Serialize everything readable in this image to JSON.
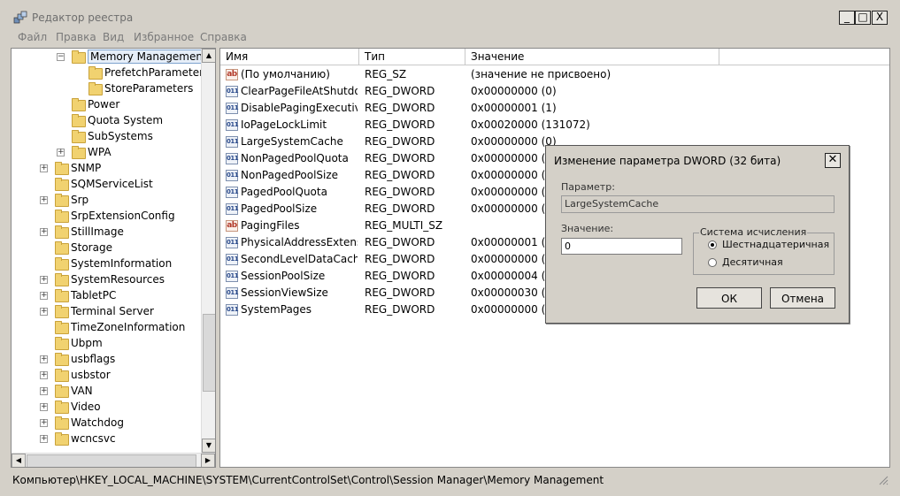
{
  "window": {
    "title": "Редактор реестра",
    "controls": {
      "minimize": "_",
      "maximize": "□",
      "close": "X"
    }
  },
  "menu": [
    "Файл",
    "Правка",
    "Вид",
    "Избранное",
    "Справка"
  ],
  "tree": {
    "selected": "Memory Management",
    "items": [
      {
        "label": "Memory Management",
        "level": 3,
        "expander": "minus",
        "selected": true
      },
      {
        "label": "PrefetchParameters",
        "level": 4,
        "expander": "none"
      },
      {
        "label": "StoreParameters",
        "level": 4,
        "expander": "none"
      },
      {
        "label": "Power",
        "level": 3,
        "expander": "none"
      },
      {
        "label": "Quota System",
        "level": 3,
        "expander": "none"
      },
      {
        "label": "SubSystems",
        "level": 3,
        "expander": "none"
      },
      {
        "label": "WPA",
        "level": 3,
        "expander": "plus"
      },
      {
        "label": "SNMP",
        "level": 2,
        "expander": "plus"
      },
      {
        "label": "SQMServiceList",
        "level": 2,
        "expander": "none"
      },
      {
        "label": "Srp",
        "level": 2,
        "expander": "plus"
      },
      {
        "label": "SrpExtensionConfig",
        "level": 2,
        "expander": "none"
      },
      {
        "label": "StillImage",
        "level": 2,
        "expander": "plus"
      },
      {
        "label": "Storage",
        "level": 2,
        "expander": "none"
      },
      {
        "label": "SystemInformation",
        "level": 2,
        "expander": "none"
      },
      {
        "label": "SystemResources",
        "level": 2,
        "expander": "plus"
      },
      {
        "label": "TabletPC",
        "level": 2,
        "expander": "plus"
      },
      {
        "label": "Terminal Server",
        "level": 2,
        "expander": "plus"
      },
      {
        "label": "TimeZoneInformation",
        "level": 2,
        "expander": "none"
      },
      {
        "label": "Ubpm",
        "level": 2,
        "expander": "none"
      },
      {
        "label": "usbflags",
        "level": 2,
        "expander": "plus"
      },
      {
        "label": "usbstor",
        "level": 2,
        "expander": "plus"
      },
      {
        "label": "VAN",
        "level": 2,
        "expander": "plus"
      },
      {
        "label": "Video",
        "level": 2,
        "expander": "plus"
      },
      {
        "label": "Watchdog",
        "level": 2,
        "expander": "plus"
      },
      {
        "label": "wcncsvc",
        "level": 2,
        "expander": "plus"
      }
    ]
  },
  "list": {
    "columns": [
      "Имя",
      "Тип",
      "Значение"
    ],
    "rows": [
      {
        "icon": "string-value-icon",
        "name": "(По умолчанию)",
        "type": "REG_SZ",
        "value": "(значение не присвоено)"
      },
      {
        "icon": "binary-value-icon",
        "name": "ClearPageFileAtShutdo...",
        "type": "REG_DWORD",
        "value": "0x00000000 (0)"
      },
      {
        "icon": "binary-value-icon",
        "name": "DisablePagingExecutive",
        "type": "REG_DWORD",
        "value": "0x00000001 (1)"
      },
      {
        "icon": "binary-value-icon",
        "name": "IoPageLockLimit",
        "type": "REG_DWORD",
        "value": "0x00020000 (131072)"
      },
      {
        "icon": "binary-value-icon",
        "name": "LargeSystemCache",
        "type": "REG_DWORD",
        "value": "0x00000000 (0)"
      },
      {
        "icon": "binary-value-icon",
        "name": "NonPagedPoolQuota",
        "type": "REG_DWORD",
        "value": "0x00000000 (0)"
      },
      {
        "icon": "binary-value-icon",
        "name": "NonPagedPoolSize",
        "type": "REG_DWORD",
        "value": "0x00000000 (0)"
      },
      {
        "icon": "binary-value-icon",
        "name": "PagedPoolQuota",
        "type": "REG_DWORD",
        "value": "0x00000000 (0)"
      },
      {
        "icon": "binary-value-icon",
        "name": "PagedPoolSize",
        "type": "REG_DWORD",
        "value": "0x00000000 (0)"
      },
      {
        "icon": "string-value-icon",
        "name": "PagingFiles",
        "type": "REG_MULTI_SZ",
        "value": ""
      },
      {
        "icon": "binary-value-icon",
        "name": "PhysicalAddressExtensi...",
        "type": "REG_DWORD",
        "value": "0x00000001 (1)"
      },
      {
        "icon": "binary-value-icon",
        "name": "SecondLevelDataCache",
        "type": "REG_DWORD",
        "value": "0x00000000 (0)"
      },
      {
        "icon": "binary-value-icon",
        "name": "SessionPoolSize",
        "type": "REG_DWORD",
        "value": "0x00000004 (4)"
      },
      {
        "icon": "binary-value-icon",
        "name": "SessionViewSize",
        "type": "REG_DWORD",
        "value": "0x00000030 (48)"
      },
      {
        "icon": "binary-value-icon",
        "name": "SystemPages",
        "type": "REG_DWORD",
        "value": "0x00000000 (0)"
      }
    ]
  },
  "status": {
    "path": "Компьютер\\HKEY_LOCAL_MACHINE\\SYSTEM\\CurrentControlSet\\Control\\Session Manager\\Memory Management"
  },
  "dialog": {
    "title": "Изменение параметра DWORD (32 бита)",
    "param_label": "Параметр:",
    "param_value": "LargeSystemCache",
    "value_label": "Значение:",
    "value": "0",
    "radix_label": "Система исчисления",
    "radix_options": [
      "Шестнадцатеричная",
      "Десятичная"
    ],
    "radix_selected": "Шестнадцатеричная",
    "ok_label": "ОК",
    "cancel_label": "Отмена"
  }
}
